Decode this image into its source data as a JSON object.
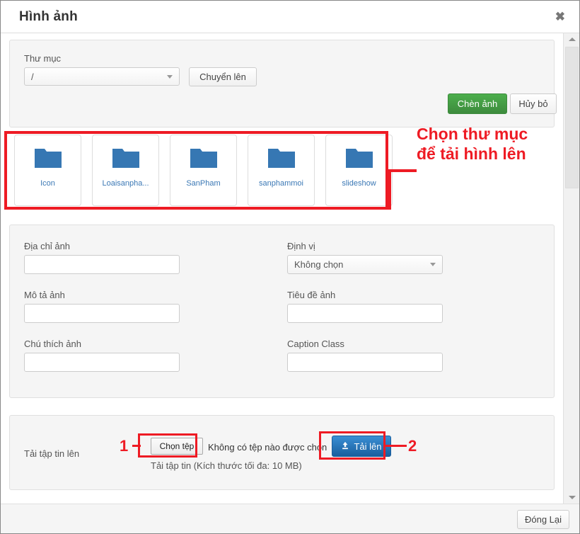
{
  "window": {
    "title": "Hình ảnh",
    "close_icon": "close-icon",
    "close_glyph": "✖"
  },
  "folder_nav": {
    "folder_label": "Thư mục",
    "folder_select_value": "/",
    "move_up_label": "Chuyển lên",
    "insert_image_label": "Chèn ảnh",
    "cancel_label": "Hủy bỏ"
  },
  "folders": [
    {
      "name": "Icon",
      "icon": "folder-icon"
    },
    {
      "name": "Loaisanpha...",
      "icon": "folder-icon"
    },
    {
      "name": "SanPham",
      "icon": "folder-icon"
    },
    {
      "name": "sanphammoi",
      "icon": "folder-icon"
    },
    {
      "name": "slideshow",
      "icon": "folder-icon"
    }
  ],
  "annotations": {
    "folder_note": "Chọn thư mục\nđể tải hình lên",
    "marker_1": "1",
    "marker_2": "2",
    "color": "#ee1b24"
  },
  "fields": {
    "image_url_label": "Địa chỉ ảnh",
    "image_url_value": "",
    "description_label": "Mô tả ảnh",
    "description_value": "",
    "caption_label": "Chú thích ảnh",
    "caption_value": "",
    "align_label": "Định vị",
    "align_value": "Không chọn",
    "title_label": "Tiêu đề ảnh",
    "title_value": "",
    "caption_class_label": "Caption Class",
    "caption_class_value": ""
  },
  "upload": {
    "row_label": "Tải tập tin lên",
    "choose_file_label": "Chọn tệp",
    "no_file_text": "Không có tệp nào được chọn",
    "upload_button_label": "Tải lên",
    "upload_icon": "upload-icon",
    "help_text": "Tải tập tin (Kích thước tối đa: 10 MB)"
  },
  "footer": {
    "close_label": "Đóng Lại"
  },
  "scrollbar": {
    "up_icon": "arrow-up-icon",
    "down_icon": "arrow-down-icon"
  },
  "colors": {
    "accent_green": "#4cae4c",
    "accent_blue": "#1a5f9e",
    "folder_blue": "#3677b3",
    "annotation_red": "#ee1b24"
  }
}
